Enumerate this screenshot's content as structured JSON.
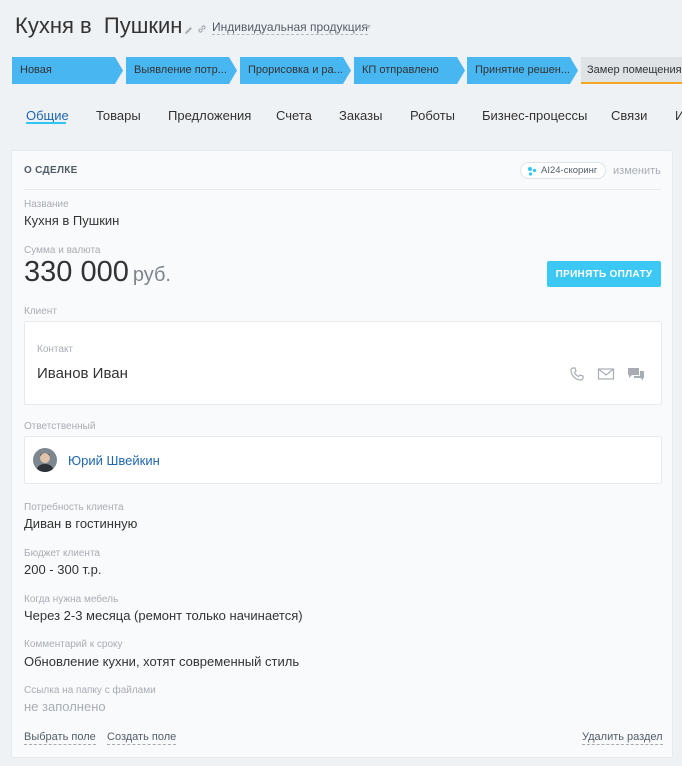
{
  "header": {
    "title": "Кухня в  Пушкин",
    "category": "Индивидуальная продукция"
  },
  "stages": [
    {
      "label": "Новая",
      "color": "#48b6f0"
    },
    {
      "label": "Выявление потр...",
      "color": "#48b6f0"
    },
    {
      "label": "Прорисовка и ра...",
      "color": "#48b6f0"
    },
    {
      "label": "КП отправлено",
      "color": "#48b6f0"
    },
    {
      "label": "Принятие решен...",
      "color": "#48b6f0"
    },
    {
      "label": "Замер помещения",
      "color": "#dfe3e6",
      "accent": "#f5a623"
    }
  ],
  "tabs": [
    "Общие",
    "Товары",
    "Предложения",
    "Счета",
    "Заказы",
    "Роботы",
    "Бизнес-процессы",
    "Связи",
    "И"
  ],
  "card": {
    "section_title": "О СДЕЛКЕ",
    "ai_badge": "AI24-скоринг",
    "change_label": "изменить",
    "name_label": "Название",
    "name_value": "Кухня в Пушкин",
    "sum_label": "Сумма и валюта",
    "sum_value": "330 000",
    "currency": "руб.",
    "pay_button": "ПРИНЯТЬ ОПЛАТУ",
    "client_label": "Клиент",
    "contact_label": "Контакт",
    "contact_name": "Иванов Иван",
    "responsible_label": "Ответственный",
    "responsible_name": "Юрий Швейкин",
    "need_label": "Потребность клиента",
    "need_value": "Диван в гостинную",
    "budget_label": "Бюджет клиента",
    "budget_value": "200 - 300 т.р.",
    "when_label": "Когда нужна мебель",
    "when_value": "Через 2-3 месяца (ремонт только начинается)",
    "comment_label": "Комментарий к сроку",
    "comment_value": "Обновление кухни, хотят современный стиль",
    "folder_label": "Ссылка на папку с файлами",
    "folder_value": "не заполнено",
    "select_field": "Выбрать поле",
    "create_field": "Создать поле",
    "delete_section": "Удалить раздел"
  },
  "colors": {
    "accent": "#2fc6f6",
    "link": "#2067b0",
    "stage_done": "#48b6f0"
  }
}
